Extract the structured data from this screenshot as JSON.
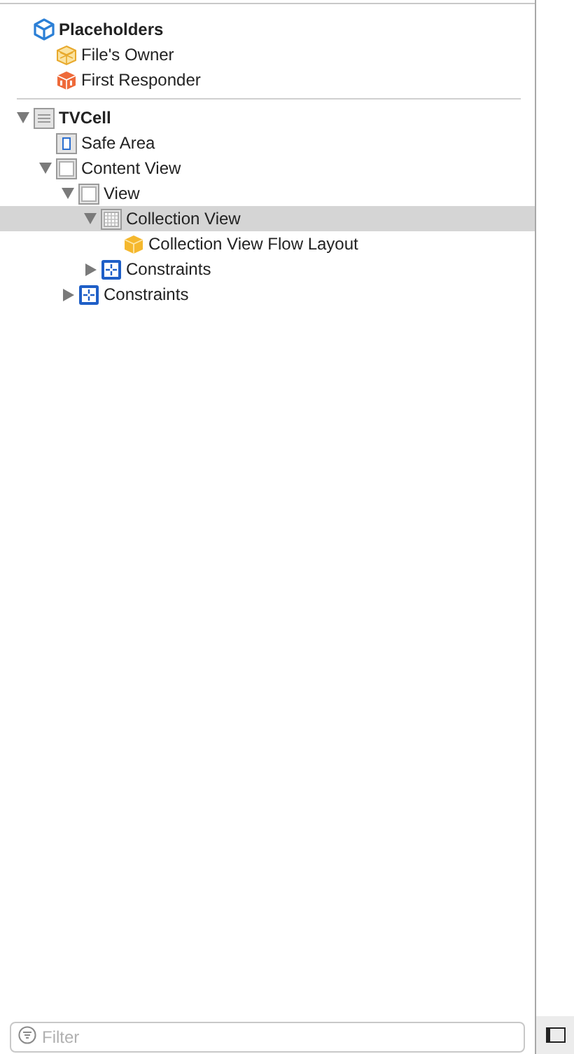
{
  "outline": {
    "sections": [
      {
        "label": "Placeholders",
        "kind": "placeholders",
        "selected": false,
        "children": [
          {
            "label": "File's Owner",
            "kind": "files-owner",
            "selected": false
          },
          {
            "label": "First Responder",
            "kind": "first-responder",
            "selected": false
          }
        ]
      },
      {
        "label": "TVCell",
        "kind": "cell",
        "selected": false,
        "expanded": true,
        "children": [
          {
            "label": "Safe Area",
            "kind": "safe-area",
            "selected": false
          },
          {
            "label": "Content View",
            "kind": "view",
            "selected": false,
            "expanded": true,
            "children": [
              {
                "label": "View",
                "kind": "view",
                "selected": false,
                "expanded": true,
                "children": [
                  {
                    "label": "Collection View",
                    "kind": "collection-view",
                    "selected": true,
                    "expanded": true,
                    "children": [
                      {
                        "label": "Collection View Flow Layout",
                        "kind": "flow-layout",
                        "selected": false
                      }
                    ]
                  },
                  {
                    "label": "Constraints",
                    "kind": "constraints",
                    "selected": false,
                    "expanded": false
                  }
                ]
              },
              {
                "label": "Constraints",
                "kind": "constraints",
                "selected": false,
                "expanded": false
              }
            ]
          }
        ]
      }
    ]
  },
  "filter": {
    "placeholder": "Filter"
  }
}
